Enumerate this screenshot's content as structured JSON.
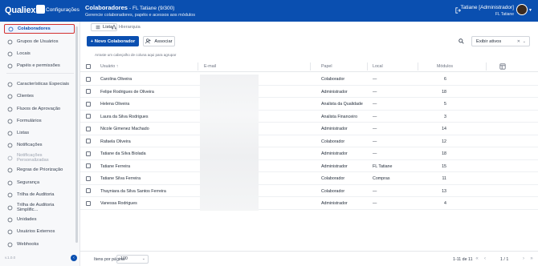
{
  "app": {
    "brand": "Qualiex",
    "brand_sub": "Configurações",
    "page_title": "Colaboradores",
    "page_count": "- FL Tatiane (9/300)",
    "page_subtitle": "Gerencie colaboradores, papéis e acessos aos módulos",
    "user_name": "Tatiane [Administrador]",
    "user_company": "FL Tatiane"
  },
  "sidebar": {
    "items": [
      {
        "label": "Colaboradores",
        "icon": "users-icon",
        "active": true
      },
      {
        "label": "Grupos de Usuários",
        "icon": "user-group-icon"
      },
      {
        "label": "Locais",
        "icon": "map-pin-icon"
      },
      {
        "label": "Papéis e permissões",
        "icon": "shield-icon"
      },
      {
        "label": "Características Especiais",
        "icon": "star-icon"
      },
      {
        "label": "Clientes",
        "icon": "client-icon"
      },
      {
        "label": "Fluxos de Aprovação",
        "icon": "flow-icon"
      },
      {
        "label": "Formulários",
        "icon": "form-icon"
      },
      {
        "label": "Listas",
        "icon": "list-icon"
      },
      {
        "label": "Notificações",
        "icon": "bell-icon"
      },
      {
        "label": "Notificações Personalizadas",
        "icon": "bell-cog-icon",
        "disabled": true
      },
      {
        "label": "Regras de Priorização",
        "icon": "priority-icon"
      },
      {
        "label": "Segurança",
        "icon": "lock-icon"
      },
      {
        "label": "Trilha de Auditoria",
        "icon": "audit-icon"
      },
      {
        "label": "Trilha de Auditoria Simplific...",
        "icon": "audit-simple-icon"
      },
      {
        "label": "Unidades",
        "icon": "building-icon"
      },
      {
        "label": "Usuários Externos",
        "icon": "external-user-icon"
      },
      {
        "label": "Webhooks",
        "icon": "webhook-icon"
      }
    ],
    "footer": "v.1.0.0"
  },
  "tabs": [
    {
      "label": "Lista",
      "icon": "list-icon",
      "active": true
    },
    {
      "label": "Hierarquia",
      "icon": "hierarchy-icon"
    }
  ],
  "toolbar": {
    "new_label": "+  Novo Colaborador",
    "associate_label": "Associar",
    "filter_value": "Exibir ativos",
    "group_hint": "Arraste um cabeçalho de coluna aqui para agrupar"
  },
  "table": {
    "columns": [
      "Usuário",
      "E-mail",
      "Papel",
      "Local",
      "Módulos"
    ],
    "rows": [
      {
        "user": "Carolina Oliveira",
        "role": "Colaborador",
        "local": "—",
        "modules": "6"
      },
      {
        "user": "Felipe Rodrigues de Oliveira",
        "role": "Administrador",
        "local": "—",
        "modules": "18"
      },
      {
        "user": "Helena Oliveira",
        "role": "Analista da Qualidade",
        "local": "—",
        "modules": "5"
      },
      {
        "user": "Laura da Silva Rodrigues",
        "role": "Analista Financeiro",
        "local": "—",
        "modules": "3"
      },
      {
        "user": "Nicole Gimenez Machado",
        "role": "Administrador",
        "local": "—",
        "modules": "14"
      },
      {
        "user": "Rafaela Oliveira",
        "role": "Colaborador",
        "local": "—",
        "modules": "12"
      },
      {
        "user": "Tatiane da Silva Biolada",
        "role": "Administrador",
        "local": "—",
        "modules": "18"
      },
      {
        "user": "Tatiane Ferreira",
        "role": "Administrador",
        "local": "FL Tatiane",
        "modules": "15"
      },
      {
        "user": "Tatiane Silva Ferreira",
        "role": "Colaborador",
        "local": "Compras",
        "modules": "11"
      },
      {
        "user": "Thayniara da Silva Santos Ferreira",
        "role": "Colaborador",
        "local": "—",
        "modules": "13"
      },
      {
        "user": "Vanessa Rodrigues",
        "role": "Administrador",
        "local": "—",
        "modules": "4"
      }
    ]
  },
  "footer": {
    "per_page_label": "Itens por página",
    "per_page_value": "100",
    "range": "1-11 de 11",
    "pages": "1 / 1"
  },
  "colors": {
    "primary": "#0a4fb0",
    "active_outline": "#d32f2f"
  }
}
